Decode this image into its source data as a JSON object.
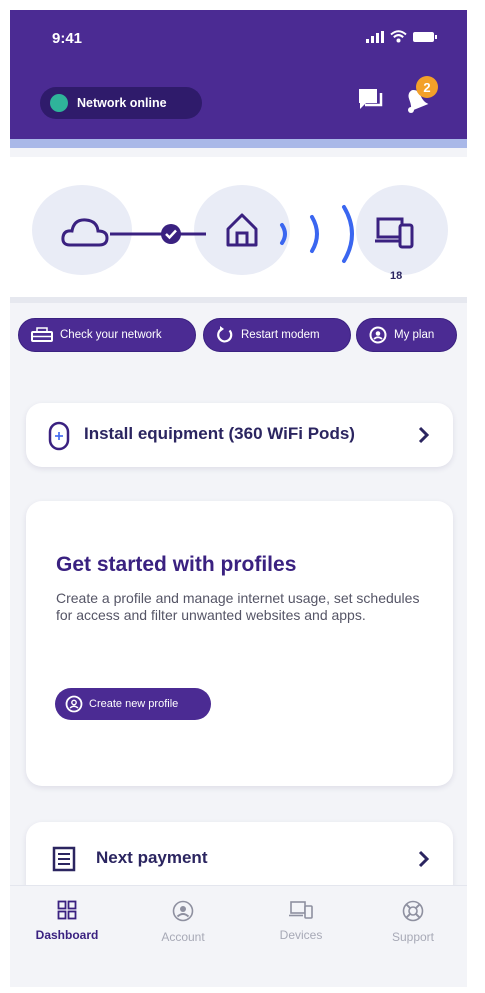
{
  "status_bar": {
    "time": "9:41"
  },
  "header": {
    "network_status": "Network online",
    "notification_count": "2"
  },
  "topology": {
    "device_count": "18"
  },
  "actions": [
    {
      "label": "Check your network",
      "icon": "router-icon"
    },
    {
      "label": "Restart modem",
      "icon": "restart-icon"
    },
    {
      "label": "My plan",
      "icon": "plan-icon"
    }
  ],
  "install_card": {
    "label": "Install equipment (360 WiFi Pods)"
  },
  "profile_card": {
    "title": "Get started with profiles",
    "description": "Create a profile and manage internet usage, set schedules for access and filter unwanted websites and apps.",
    "button_label": "Create new profile"
  },
  "payment_card": {
    "label": "Next payment"
  },
  "tabbar": [
    {
      "label": "Dashboard",
      "active": true
    },
    {
      "label": "Account",
      "active": false
    },
    {
      "label": "Devices",
      "active": false
    },
    {
      "label": "Support",
      "active": false
    }
  ],
  "colors": {
    "brand_purple": "#4b2b93",
    "online_green": "#2fb39a",
    "badge_orange": "#f3a029"
  }
}
